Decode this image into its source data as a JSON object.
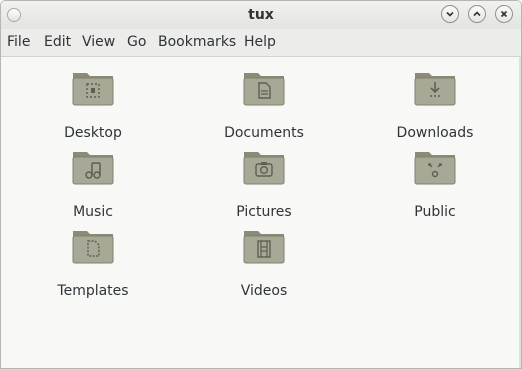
{
  "window": {
    "title": "tux"
  },
  "menubar": {
    "items": [
      "File",
      "Edit",
      "View",
      "Go",
      "Bookmarks",
      "Help"
    ]
  },
  "folders": [
    {
      "label": "Desktop",
      "icon": "desktop-folder-icon"
    },
    {
      "label": "Documents",
      "icon": "documents-folder-icon"
    },
    {
      "label": "Downloads",
      "icon": "downloads-folder-icon"
    },
    {
      "label": "Music",
      "icon": "music-folder-icon"
    },
    {
      "label": "Pictures",
      "icon": "pictures-folder-icon"
    },
    {
      "label": "Public",
      "icon": "public-folder-icon"
    },
    {
      "label": "Templates",
      "icon": "templates-folder-icon"
    },
    {
      "label": "Videos",
      "icon": "videos-folder-icon"
    }
  ],
  "colors": {
    "folder_body": "#a8a896",
    "folder_dark": "#7f7f6c",
    "folder_glyph": "#5f5f50",
    "text": "#2e3436"
  }
}
